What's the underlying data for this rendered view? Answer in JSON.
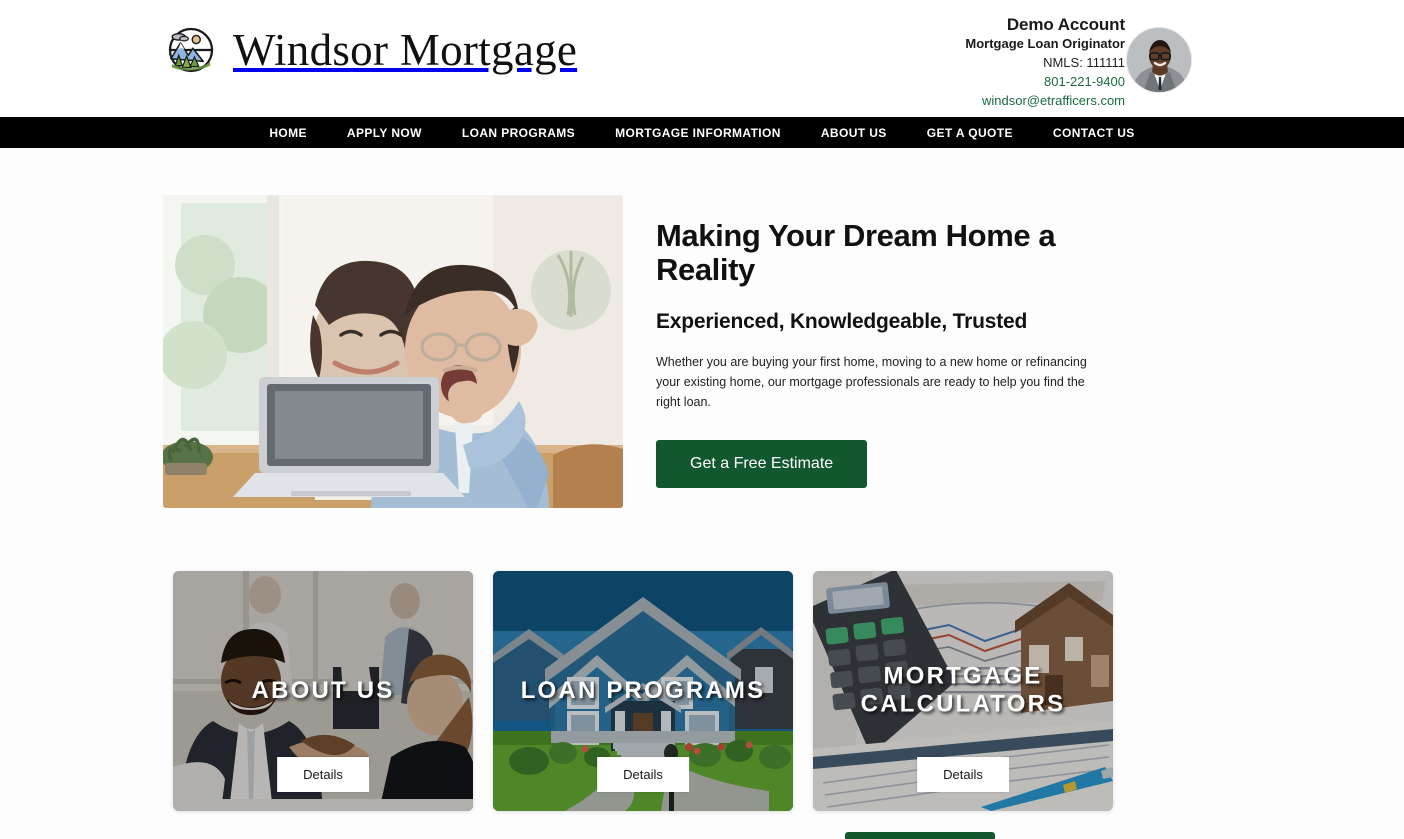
{
  "header": {
    "logo": {
      "icon": "mountain-sun-circle-logo-icon",
      "text": "Windsor Mortgage"
    },
    "contact": {
      "name": "Demo Account",
      "title": "Mortgage Loan Originator",
      "nmls": "NMLS: 111111",
      "phone": "801-221-9400",
      "email": "windsor@etrafficers.com",
      "link_color": "#1c6b3c",
      "avatar": "loan-officer-avatar"
    }
  },
  "nav": {
    "background": "#000000",
    "items": [
      {
        "label": "HOME"
      },
      {
        "label": "APPLY NOW"
      },
      {
        "label": "LOAN PROGRAMS"
      },
      {
        "label": "MORTGAGE INFORMATION"
      },
      {
        "label": "ABOUT US"
      },
      {
        "label": "GET A QUOTE"
      },
      {
        "label": "CONTACT US"
      }
    ]
  },
  "hero": {
    "image_alt": "happy-couple-at-laptop-photo",
    "title": "Making Your Dream Home a Reality",
    "subtitle": "Experienced, Knowledgeable, Trusted",
    "body": "Whether you are buying your first home, moving to a new home or refinancing your existing home, our mortgage professionals are ready to help you find the right loan.",
    "cta_label": "Get a Free Estimate",
    "cta_color": "#11572f"
  },
  "cards": [
    {
      "title": "ABOUT US",
      "details_label": "Details",
      "image_alt": "business-handshake-photo"
    },
    {
      "title": "LOAN PROGRAMS",
      "details_label": "Details",
      "image_alt": "blue-two-story-house-photo"
    },
    {
      "title": "MORTGAGE CALCULATORS",
      "details_label": "Details",
      "image_alt": "calculator-mortgage-documents-photo"
    }
  ],
  "footer_accent": {
    "color": "#11572f"
  }
}
